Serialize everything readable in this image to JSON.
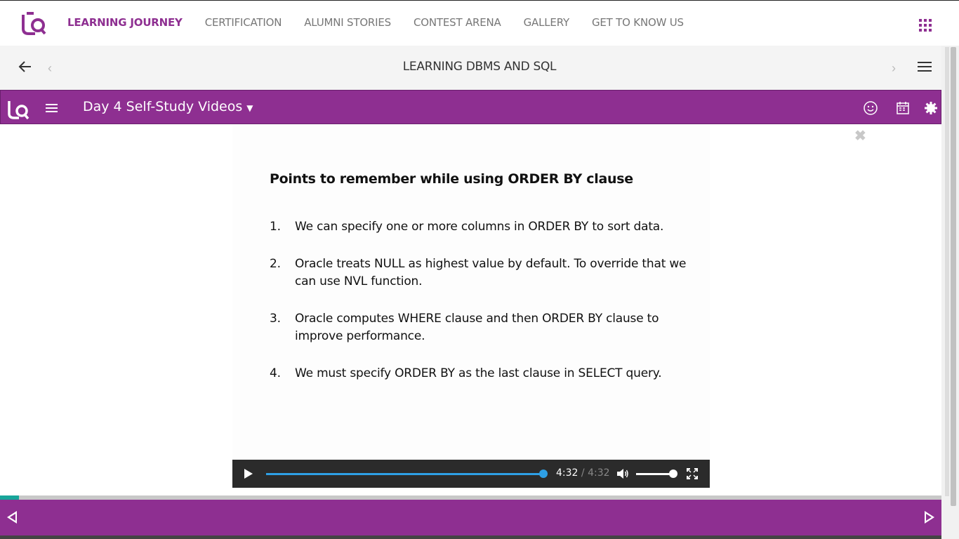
{
  "topnav": {
    "items": [
      {
        "label": "LEARNING JOURNEY"
      },
      {
        "label": "CERTIFICATION"
      },
      {
        "label": "ALUMNI STORIES"
      },
      {
        "label": "CONTEST ARENA"
      },
      {
        "label": "GALLERY"
      },
      {
        "label": "GET TO KNOW US"
      }
    ],
    "active_index": 0,
    "brand_color": "#8e2f91"
  },
  "subbar": {
    "title": "LEARNING DBMS AND SQL"
  },
  "player": {
    "section_title": "Day 4 Self-Study Videos",
    "header_icons": [
      "smiley-icon",
      "calendar-icon",
      "settings-icon"
    ],
    "slide": {
      "heading": "Points to remember while using ORDER BY clause",
      "points": [
        {
          "num": "1.",
          "text": "We can specify one or more columns in ORDER BY to sort data."
        },
        {
          "num": "2.",
          "text": "Oracle treats NULL as highest value by default. To override that we can use NVL function."
        },
        {
          "num": "3.",
          "text": "Oracle computes WHERE clause and then ORDER BY clause to improve performance."
        },
        {
          "num": "4.",
          "text": "We must specify ORDER BY as the last clause in SELECT query."
        }
      ]
    },
    "controls": {
      "current_time": "4:32",
      "duration": "/ 4:32",
      "progress_fraction": 1.0,
      "volume_fraction": 0.9
    },
    "course_progress_fraction": 0.02
  }
}
